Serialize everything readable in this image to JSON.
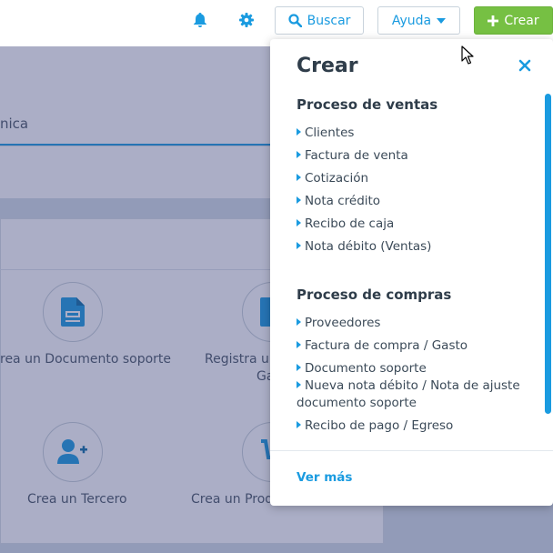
{
  "header": {
    "search_label": "Buscar",
    "help_label": "Ayuda",
    "create_label": "Crear"
  },
  "background": {
    "tab_fragment": "nica",
    "card_document": "rea un Documento soporte",
    "card_register_line1": "Registra u",
    "card_register_line2": "Ga",
    "card_third": "Crea un Tercero",
    "card_product": "Crea un Produ"
  },
  "panel": {
    "title": "Crear",
    "sections": [
      {
        "title": "Proceso de ventas",
        "items": [
          "Clientes",
          "Factura de venta",
          "Cotización",
          "Nota crédito",
          "Recibo de caja",
          "Nota débito (Ventas)"
        ]
      },
      {
        "title": "Proceso de compras",
        "items": [
          "Proveedores",
          "Factura de compra / Gasto",
          "Documento soporte",
          "Nueva nota débito / Nota de ajuste documento soporte",
          "Recibo de pago / Egreso"
        ]
      }
    ],
    "see_more": "Ver más"
  },
  "colors": {
    "accent": "#1a9be0",
    "create_button": "#76c043",
    "overlay": "#373e76"
  },
  "icons": {
    "notifications": "bell-icon",
    "settings": "gear-icon",
    "search": "search-icon",
    "dropdown": "caret-down-icon",
    "create": "plus-icon",
    "close": "close-icon"
  }
}
